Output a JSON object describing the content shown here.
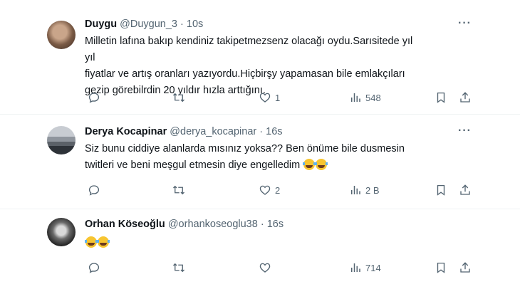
{
  "tweets": [
    {
      "name": "Duygu",
      "handle": "@Duygun_3",
      "time": "10s",
      "text": "Milletin lafına bakıp kendiniz takipetmezsenz olacağı oydu.Sarısitede yıl yıl\nfiyatlar ve artış oranları yazıyordu.Hiçbirşy yapamasan bile emlakçıları\ngezip görebilrdin 20 yıldır hızla arttığını.",
      "emoji_count": 0,
      "likes": "1",
      "views": "548"
    },
    {
      "name": "Derya Kocapinar",
      "handle": "@derya_kocapinar",
      "time": "16s",
      "text": "Siz bunu ciddiye alanlarda mısınız yoksa?? Ben önüme bile dusmesin\ntwitleri ve beni meşgul etmesin diye engelledim",
      "emoji_count": 2,
      "likes": "2",
      "views": "2 B"
    },
    {
      "name": "Orhan Köseoğlu",
      "handle": "@orhankoseoglu38",
      "time": "16s",
      "text": "",
      "emoji_count": 2,
      "likes": "",
      "views": "714"
    }
  ],
  "separator": "·",
  "more_label": "···",
  "icons": {
    "reply": "reply-icon",
    "retweet": "retweet-icon",
    "like": "heart-icon",
    "views": "views-icon",
    "bookmark": "bookmark-icon",
    "share": "share-icon",
    "emoji": "tears-of-joy-emoji"
  }
}
